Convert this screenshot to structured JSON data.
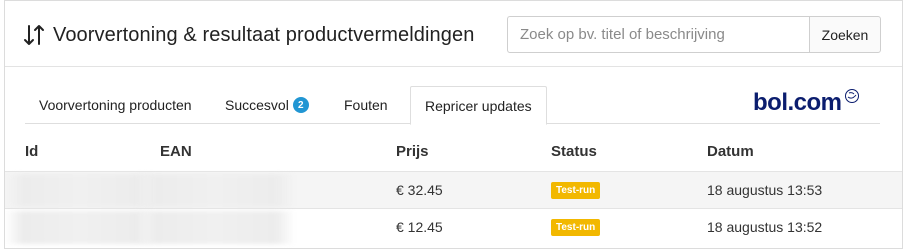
{
  "header": {
    "title": "Voorvertoning & resultaat productvermeldingen",
    "sort_icon": "sort-arrows-icon",
    "search_placeholder": "Zoek op bv. titel of beschrijving",
    "search_value": "",
    "search_button": "Zoeken"
  },
  "tabs": [
    {
      "label": "Voorvertoning producten",
      "active": false
    },
    {
      "label": "Succesvol",
      "active": false,
      "badge": "2"
    },
    {
      "label": "Fouten",
      "active": false
    },
    {
      "label": "Repricer updates",
      "active": true
    }
  ],
  "logo": {
    "text": "bol.com",
    "mark_icon": "bolcom-smile-icon",
    "color": "#0b1d6e"
  },
  "table": {
    "columns": [
      "Id",
      "EAN",
      "Prijs",
      "Status",
      "Datum"
    ],
    "rows": [
      {
        "id": "",
        "ean": "",
        "prijs": "€ 32.45",
        "status": "Test-run",
        "datum": "18 augustus 13:53"
      },
      {
        "id": "",
        "ean": "",
        "prijs": "€ 12.45",
        "status": "Test-run",
        "datum": "18 augustus 13:52"
      }
    ]
  },
  "colors": {
    "badge": "#2196d3",
    "status": "#f2b800"
  }
}
